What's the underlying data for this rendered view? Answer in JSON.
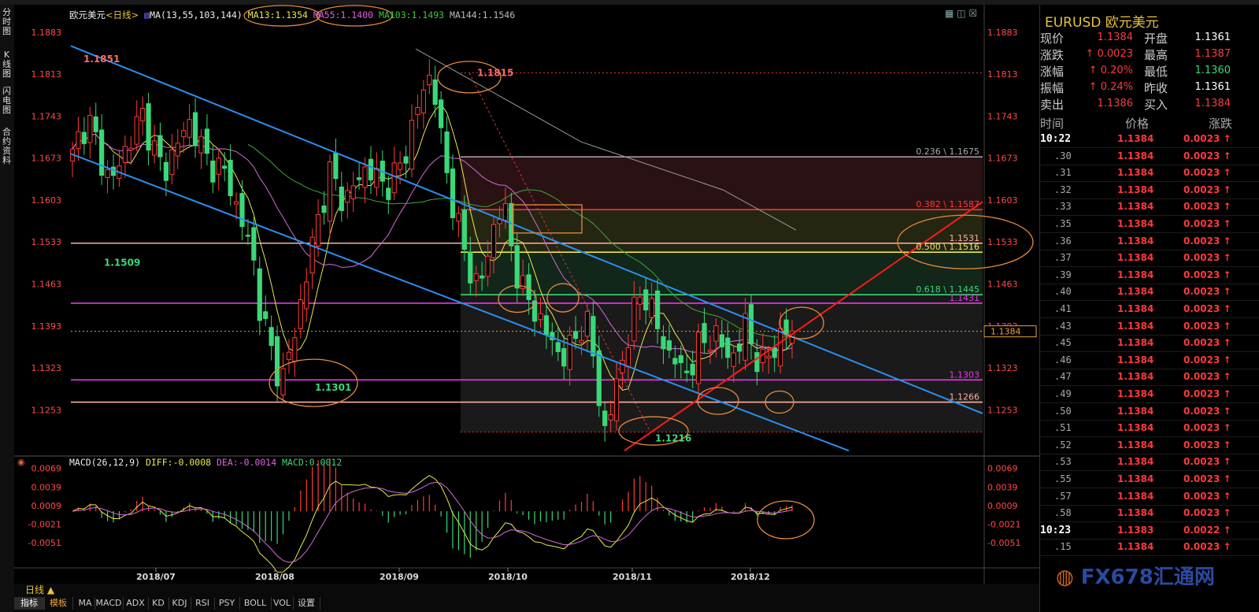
{
  "chart_header": {
    "symbol_label": "欧元美元",
    "period_label": "<日线>",
    "ma_label": "MA(13,55,103,144)",
    "ma13": "MA13:1.1354",
    "ma55": "MA55:1.1400",
    "ma103": "MA103:1.1493",
    "ma144": "MA144:1.1546"
  },
  "macd_header": {
    "label": "MACD(26,12,9)",
    "diff": "DIFF:-0.0008",
    "dea": "DEA:-0.0014",
    "macd": "MACD:0.0012"
  },
  "left_nav": [
    "分时图",
    "K线图",
    "闪电图",
    "合约资料"
  ],
  "toolbar": {
    "period": "日线 ▲",
    "tabs": [
      "指标",
      "模板"
    ],
    "indicators": [
      "MA",
      "MACD",
      "ADX",
      "KD",
      "KDJ",
      "RSI",
      "PSY",
      "BOLL",
      "VOL",
      "设置"
    ]
  },
  "colors": {
    "up": "#ff3a3a",
    "down": "#3ad878",
    "ma13": "#e8e84a",
    "ma55": "#d66ad6",
    "ma103": "#3aa83a",
    "ma144": "#9a9a9a",
    "channel": "#2a8ff0",
    "trend": "#ff1a1a",
    "annot": "#e88a3a"
  },
  "chart_data": [
    {
      "type": "candlestick",
      "title": "欧元美元 日线",
      "y_ticks": [
        "1.1883",
        "1.1813",
        "1.1743",
        "1.1673",
        "1.1603",
        "1.1533",
        "1.1463",
        "1.1393",
        "1.1323",
        "1.1253"
      ],
      "x_ticks": [
        "2018/07",
        "2018/08",
        "2018/09",
        "2018/10",
        "2018/11",
        "2018/12"
      ],
      "ylim": [
        1.118,
        1.1905
      ],
      "current_price": "1.1384",
      "price_path": [
        1.1676,
        1.1715,
        1.1738,
        1.1702,
        1.1655,
        1.1635,
        1.1662,
        1.1695,
        1.1722,
        1.1745,
        1.1705,
        1.1665,
        1.1655,
        1.1688,
        1.1712,
        1.1732,
        1.1708,
        1.1672,
        1.1662,
        1.1655,
        1.1635,
        1.159,
        1.1552,
        1.1515,
        1.142,
        1.137,
        1.1325,
        1.1305,
        1.136,
        1.142,
        1.148,
        1.1555,
        1.16,
        1.165,
        1.162,
        1.16,
        1.1625,
        1.1655,
        1.165,
        1.164,
        1.1625,
        1.164,
        1.166,
        1.1705,
        1.175,
        1.1795,
        1.1815,
        1.1715,
        1.1635,
        1.158,
        1.152,
        1.148,
        1.146,
        1.15,
        1.157,
        1.16,
        1.153,
        1.1475,
        1.144,
        1.142,
        1.14,
        1.137,
        1.135,
        1.1345,
        1.136,
        1.1395,
        1.1395,
        1.13,
        1.1216,
        1.126,
        1.132,
        1.1375,
        1.1425,
        1.1455,
        1.142,
        1.138,
        1.135,
        1.134,
        1.131,
        1.1325,
        1.1355,
        1.137,
        1.138,
        1.136,
        1.134,
        1.135,
        1.1395,
        1.136,
        1.132,
        1.1345,
        1.1365,
        1.138,
        1.1384
      ],
      "levels": [
        {
          "label": "0.236 \\ 1.1675",
          "value": 1.1675,
          "color": "#aaaaaa"
        },
        {
          "label": "0.382 \\ 1.1587",
          "value": 1.1587,
          "color": "#ff3a3a"
        },
        {
          "label": "0.500 \\ 1.1516",
          "value": 1.1516,
          "color": "#e8e84a"
        },
        {
          "label": "0.618 \\ 1.1445",
          "value": 1.1445,
          "color": "#3ad878"
        },
        {
          "label": "1.1531",
          "value": 1.1531,
          "color": "#ffb0a0"
        },
        {
          "label": "1.1431",
          "value": 1.1431,
          "color": "#e63ae6"
        },
        {
          "label": "1.1303",
          "value": 1.1303,
          "color": "#e63ae6"
        },
        {
          "label": "1.1266",
          "value": 1.1266,
          "color": "#ffb0a0"
        }
      ],
      "annotations": [
        "1.1851",
        "1.1509",
        "1.1815",
        "1.1301",
        "1.1216"
      ]
    },
    {
      "type": "bar",
      "title": "MACD",
      "y_ticks": [
        "0.0069",
        "0.0039",
        "0.0009",
        "-0.0021",
        "-0.0051"
      ],
      "ylim": [
        -0.0085,
        0.0075
      ]
    }
  ],
  "right_panel": {
    "title": "EURUSD 欧元美元",
    "quote_rows": [
      {
        "l1": "现价",
        "v1": "1.1384",
        "c1": "red",
        "l2": "开盘",
        "v2": "1.1361",
        "c2": "white"
      },
      {
        "l1": "涨跌",
        "v1": "↑ 0.0023",
        "c1": "red",
        "l2": "最高",
        "v2": "1.1387",
        "c2": "red"
      },
      {
        "l1": "涨幅",
        "v1": "↑ 0.20%",
        "c1": "red",
        "l2": "最低",
        "v2": "1.1360",
        "c2": "green"
      },
      {
        "l1": "振幅",
        "v1": "↑ 0.24%",
        "c1": "red",
        "l2": "昨收",
        "v2": "1.1361",
        "c2": "white"
      },
      {
        "l1": "卖出",
        "v1": "1.1386",
        "c1": "red",
        "l2": "买入",
        "v2": "1.1384",
        "c2": "red"
      }
    ],
    "trade_headers": [
      "时间",
      "价格",
      "涨跌"
    ],
    "trades": [
      {
        "time": "10:22",
        "major": true,
        "price": "1.1384",
        "change": "0.0023 ↑"
      },
      {
        "time": ".30",
        "price": "1.1384",
        "change": "0.0023 ↑"
      },
      {
        "time": ".31",
        "price": "1.1384",
        "change": "0.0023 ↑"
      },
      {
        "time": ".32",
        "price": "1.1384",
        "change": "0.0023 ↑"
      },
      {
        "time": ".33",
        "price": "1.1384",
        "change": "0.0023 ↑"
      },
      {
        "time": ".35",
        "price": "1.1384",
        "change": "0.0023 ↑"
      },
      {
        "time": ".36",
        "price": "1.1384",
        "change": "0.0023 ↑"
      },
      {
        "time": ".37",
        "price": "1.1384",
        "change": "0.0023 ↑"
      },
      {
        "time": ".39",
        "price": "1.1384",
        "change": "0.0023 ↑"
      },
      {
        "time": ".40",
        "price": "1.1384",
        "change": "0.0023 ↑"
      },
      {
        "time": ".41",
        "price": "1.1384",
        "change": "0.0023 ↑"
      },
      {
        "time": ".43",
        "price": "1.1384",
        "change": "0.0023 ↑"
      },
      {
        "time": ".45",
        "price": "1.1384",
        "change": "0.0023 ↑"
      },
      {
        "time": ".46",
        "price": "1.1384",
        "change": "0.0023 ↑"
      },
      {
        "time": ".47",
        "price": "1.1384",
        "change": "0.0023 ↑"
      },
      {
        "time": ".49",
        "price": "1.1384",
        "change": "0.0023 ↑"
      },
      {
        "time": ".50",
        "price": "1.1384",
        "change": "0.0023 ↑"
      },
      {
        "time": ".51",
        "price": "1.1384",
        "change": "0.0023 ↑"
      },
      {
        "time": ".52",
        "price": "1.1384",
        "change": "0.0023 ↑"
      },
      {
        "time": ".53",
        "price": "1.1384",
        "change": "0.0023 ↑"
      },
      {
        "time": ".55",
        "price": "1.1384",
        "change": "0.0023 ↑"
      },
      {
        "time": ".57",
        "price": "1.1384",
        "change": "0.0023 ↑"
      },
      {
        "time": ".58",
        "price": "1.1384",
        "change": "0.0023 ↑"
      },
      {
        "time": "10:23",
        "major": true,
        "price": "1.1383",
        "change": "0.0022 ↑"
      },
      {
        "time": ".15",
        "price": "1.1384",
        "change": "0.0023 ↑"
      }
    ]
  },
  "watermark": {
    "brand": "FX678",
    "cn": "汇通网"
  }
}
